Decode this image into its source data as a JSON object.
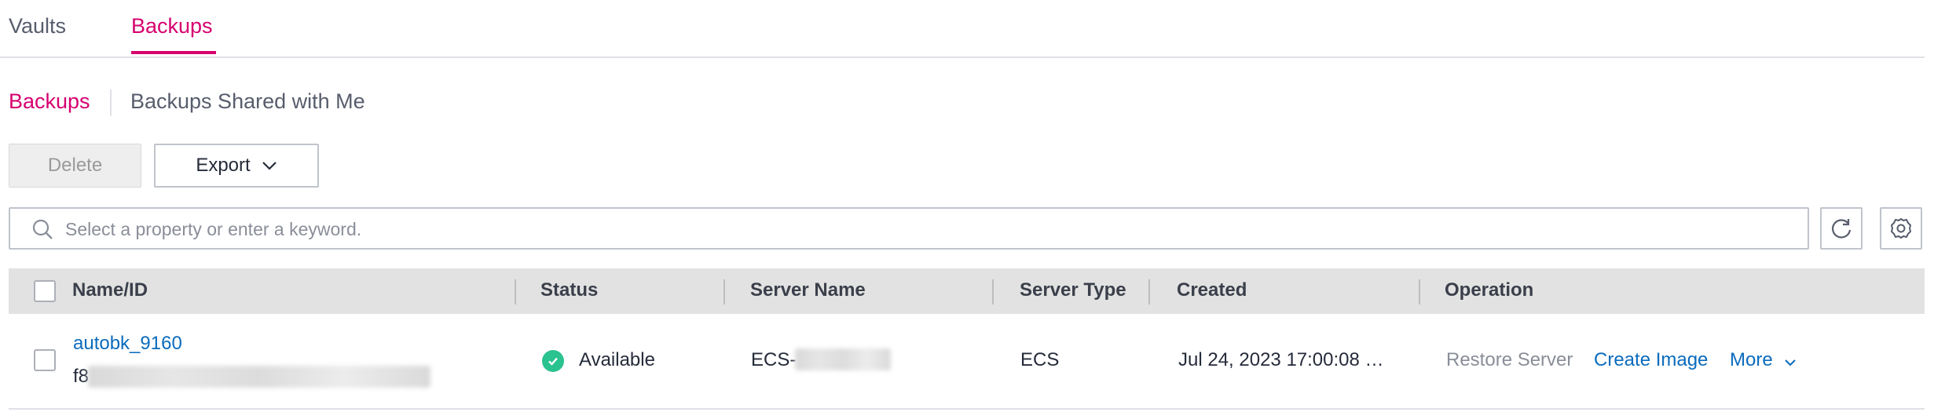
{
  "top_tabs": [
    {
      "label": "Vaults",
      "active": false
    },
    {
      "label": "Backups",
      "active": true
    }
  ],
  "sub_tabs": [
    {
      "label": "Backups",
      "active": true
    },
    {
      "label": "Backups Shared with Me",
      "active": false
    }
  ],
  "toolbar": {
    "delete_label": "Delete",
    "export_label": "Export"
  },
  "search": {
    "placeholder": "Select a property or enter a keyword.",
    "value": ""
  },
  "table": {
    "columns": [
      "Name/ID",
      "Status",
      "Server Name",
      "Server Type",
      "Created",
      "Operation"
    ],
    "rows": [
      {
        "name": "autobk_9160",
        "id_prefix": "f8",
        "status": "Available",
        "server_name_prefix": "ECS-",
        "server_type": "ECS",
        "created": "Jul 24, 2023 17:00:08 …",
        "operations": {
          "restore": "Restore Server",
          "create_image": "Create Image",
          "more": "More"
        }
      }
    ]
  },
  "colors": {
    "accent": "#d6006f",
    "link": "#0b6bbd",
    "status_available": "#2ac28f"
  },
  "icons": {
    "search": "search-icon",
    "refresh": "refresh-icon",
    "settings": "gear-icon",
    "chevron": "chevron-down-icon",
    "status": "check-circle-icon"
  }
}
